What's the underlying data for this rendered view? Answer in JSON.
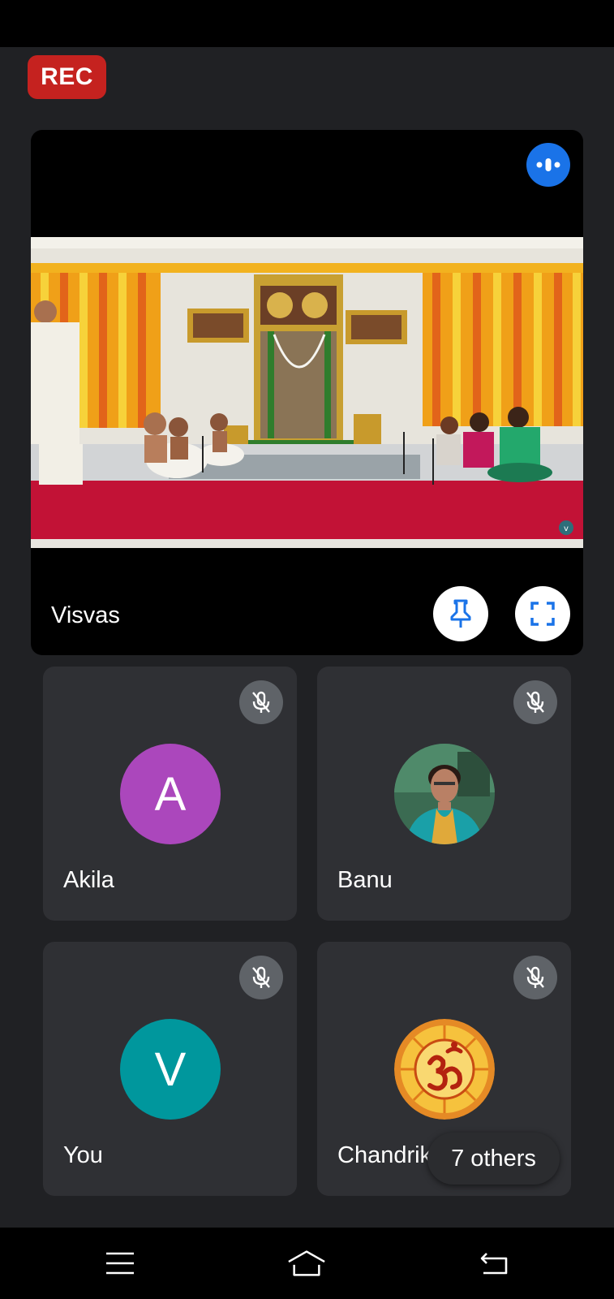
{
  "recording": {
    "label": "REC",
    "color": "#c5221f"
  },
  "main_tile": {
    "name": "Visvas",
    "speaking_icon": "audio-wave-icon",
    "pin_icon": "pin-icon",
    "fullscreen_icon": "fullscreen-icon",
    "video_watermark": "v"
  },
  "participants": [
    {
      "name": "Akila",
      "initial": "A",
      "avatar_color": "#ab47bc",
      "mic": "muted"
    },
    {
      "name": "Banu",
      "initial": "",
      "avatar_color": "#3b6b52",
      "mic": "muted"
    },
    {
      "name": "You",
      "initial": "V",
      "avatar_color": "#00979d",
      "mic": "muted"
    },
    {
      "name": "Chandrika",
      "initial": "",
      "avatar_color": "#e58a25",
      "mic": "muted"
    }
  ],
  "others_chip": {
    "label": "7 others"
  },
  "nav": {
    "menu_icon": "menu-icon",
    "home_icon": "home-icon",
    "back_icon": "back-icon"
  }
}
